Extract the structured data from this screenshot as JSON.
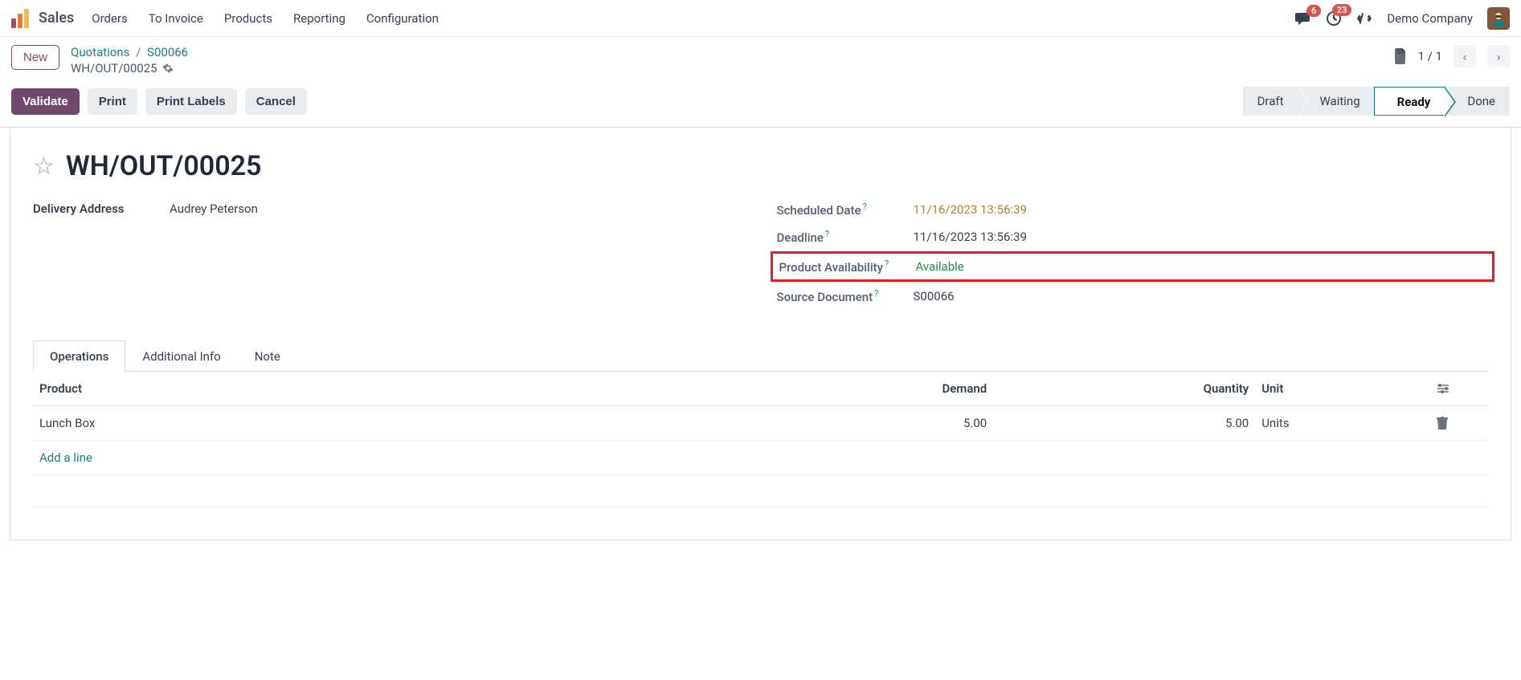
{
  "app": {
    "title": "Sales"
  },
  "nav": {
    "items": [
      "Orders",
      "To Invoice",
      "Products",
      "Reporting",
      "Configuration"
    ]
  },
  "topright": {
    "msg_badge": "6",
    "activity_badge": "23",
    "company": "Demo Company"
  },
  "breadcrumb": {
    "new_btn": "New",
    "link1": "Quotations",
    "link2": "S00066",
    "current": "WH/OUT/00025",
    "pager": "1 / 1"
  },
  "actions": {
    "validate": "Validate",
    "print": "Print",
    "print_labels": "Print Labels",
    "cancel": "Cancel"
  },
  "status": {
    "steps": [
      "Draft",
      "Waiting",
      "Ready",
      "Done"
    ],
    "active_index": 2
  },
  "record": {
    "title": "WH/OUT/00025",
    "left": {
      "delivery_address_label": "Delivery Address",
      "delivery_address_value": "Audrey Peterson"
    },
    "right": {
      "scheduled_label": "Scheduled Date",
      "scheduled_value": "11/16/2023 13:56:39",
      "deadline_label": "Deadline",
      "deadline_value": "11/16/2023 13:56:39",
      "availability_label": "Product Availability",
      "availability_value": "Available",
      "source_label": "Source Document",
      "source_value": "S00066"
    }
  },
  "tabs": [
    "Operations",
    "Additional Info",
    "Note"
  ],
  "table": {
    "headers": {
      "product": "Product",
      "demand": "Demand",
      "quantity": "Quantity",
      "unit": "Unit"
    },
    "rows": [
      {
        "product": "Lunch Box",
        "demand": "5.00",
        "quantity": "5.00",
        "unit": "Units"
      }
    ],
    "add_line": "Add a line"
  }
}
